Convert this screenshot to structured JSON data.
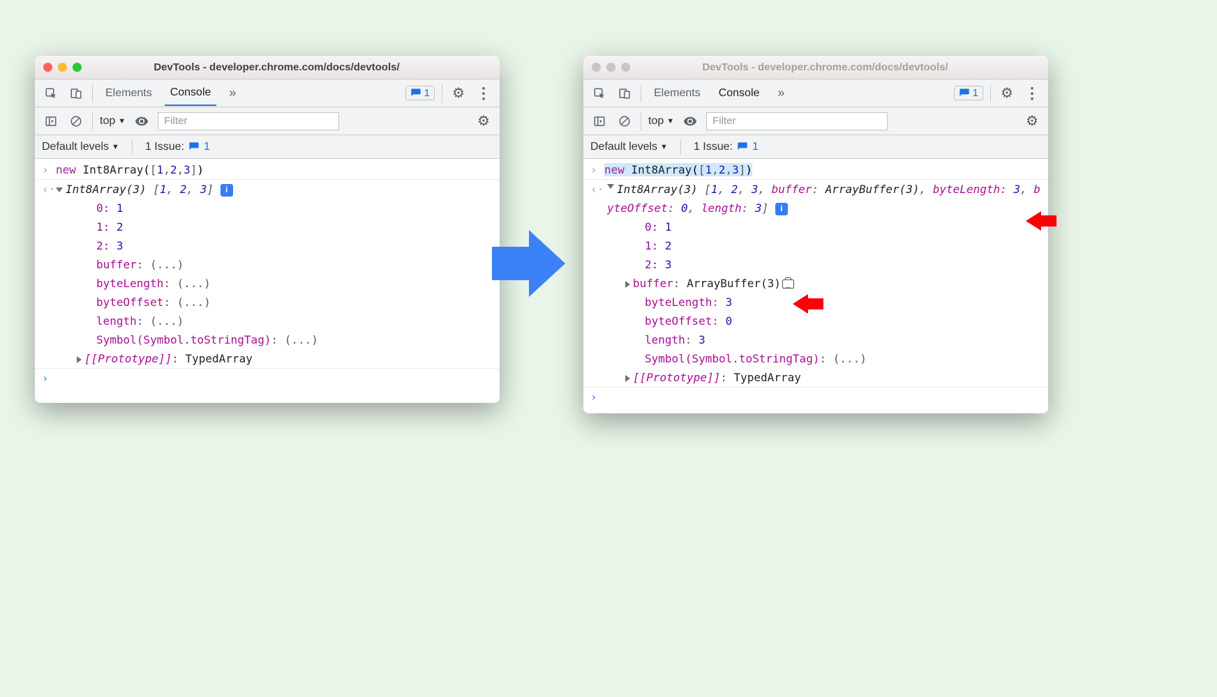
{
  "windowTitle": "DevTools - developer.chrome.com/docs/devtools/",
  "tabs": {
    "elements": "Elements",
    "console": "Console"
  },
  "issueBadge": "1",
  "contextLabel": "top",
  "filterPlaceholder": "Filter",
  "levelsLabel": "Default levels",
  "issueLabel": "1 Issue:",
  "issueLinkCount": "1",
  "input": "new Int8Array([1,2,3])",
  "left": {
    "header": "Int8Array(3) [1, 2, 3]",
    "entries": [
      {
        "k": "0",
        "v": "1"
      },
      {
        "k": "1",
        "v": "2"
      },
      {
        "k": "2",
        "v": "3"
      }
    ],
    "lazy": [
      {
        "k": "buffer",
        "v": "(...)"
      },
      {
        "k": "byteLength",
        "v": "(...)"
      },
      {
        "k": "byteOffset",
        "v": "(...)"
      },
      {
        "k": "length",
        "v": "(...)"
      },
      {
        "k": "Symbol(Symbol.toStringTag)",
        "v": "(...)"
      }
    ],
    "proto": {
      "k": "[[Prototype]]",
      "v": "TypedArray"
    }
  },
  "right": {
    "headerFull": "Int8Array(3) [1, 2, 3, buffer: ArrayBuffer(3), byteLength: 3, byteOffset: 0, length: 3]",
    "entries": [
      {
        "k": "0",
        "v": "1"
      },
      {
        "k": "1",
        "v": "2"
      },
      {
        "k": "2",
        "v": "3"
      }
    ],
    "buffer": {
      "k": "buffer",
      "v": "ArrayBuffer(3)"
    },
    "resolved": [
      {
        "k": "byteLength",
        "v": "3"
      },
      {
        "k": "byteOffset",
        "v": "0"
      },
      {
        "k": "length",
        "v": "3"
      },
      {
        "k": "Symbol(Symbol.toStringTag)",
        "v": "(...)"
      }
    ],
    "proto": {
      "k": "[[Prototype]]",
      "v": "TypedArray"
    }
  }
}
